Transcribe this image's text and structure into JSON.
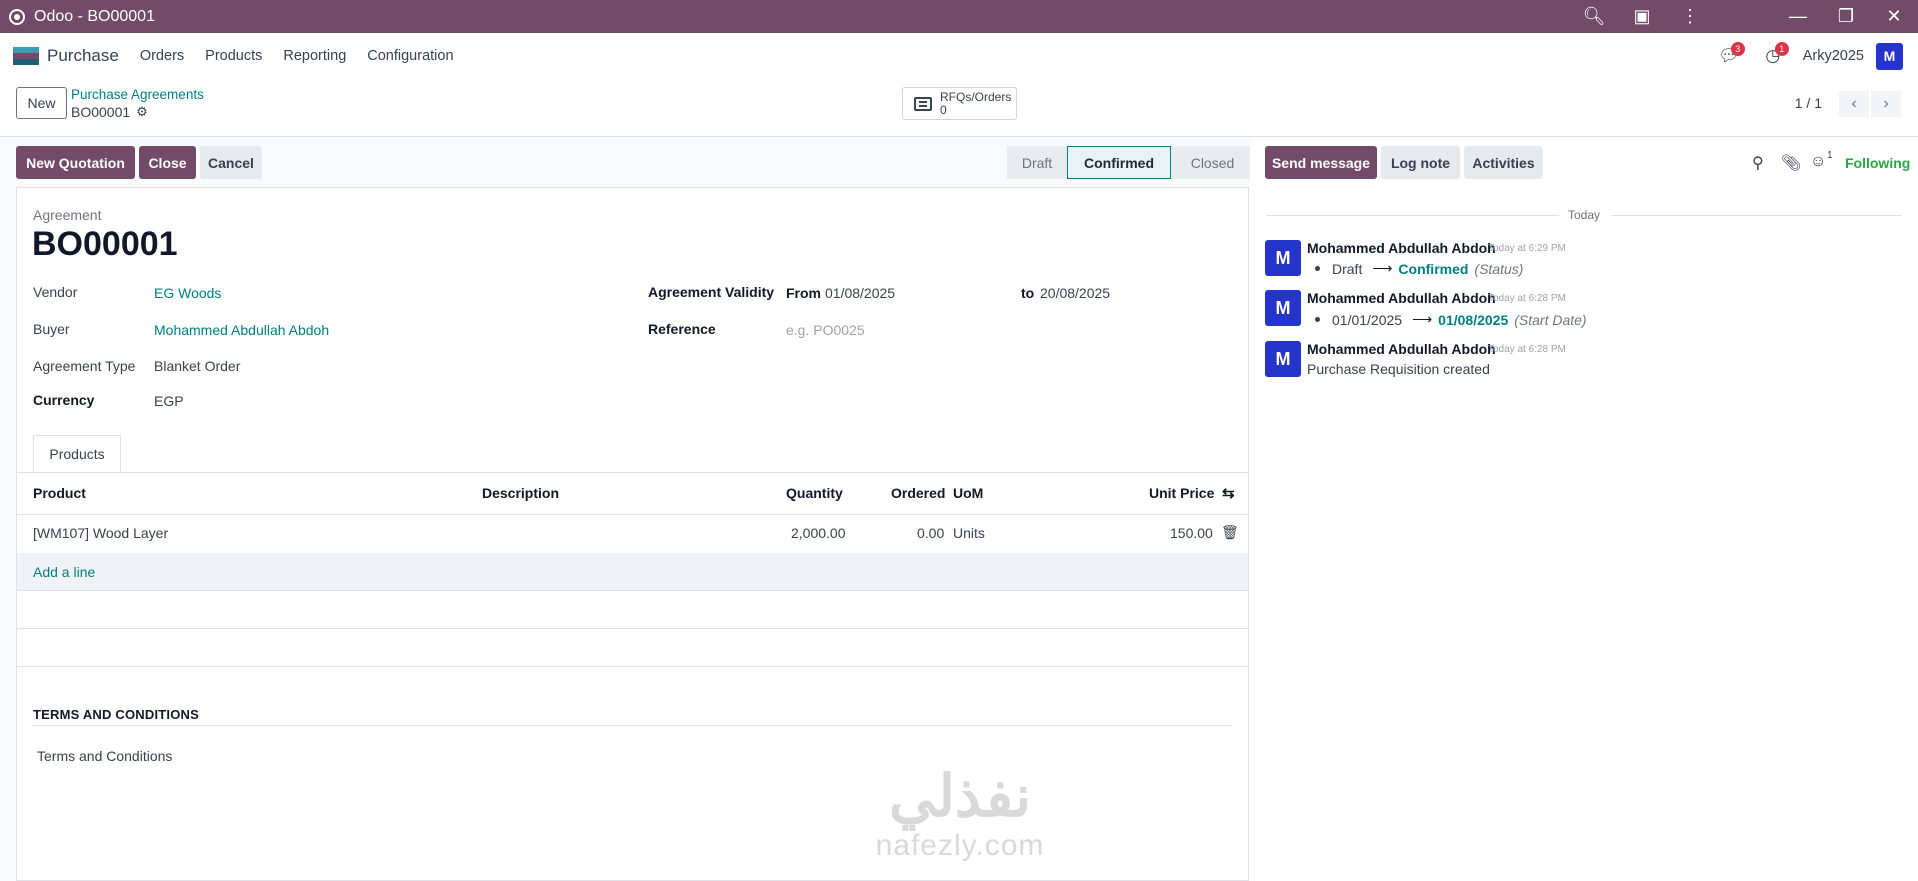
{
  "window": {
    "title": "Odoo - BO00001"
  },
  "navbar": {
    "app_name": "Purchase",
    "menu": [
      "Orders",
      "Products",
      "Reporting",
      "Configuration"
    ],
    "messages_badge": "3",
    "activities_badge": "1",
    "user_name": "Arky2025",
    "user_initial": "M"
  },
  "control_panel": {
    "new_button": "New",
    "breadcrumb_parent": "Purchase Agreements",
    "breadcrumb_current": "BO00001",
    "smart_button_label": "RFQs/Orders",
    "smart_button_count": "0",
    "pager": "1 / 1"
  },
  "actions": {
    "new_quotation": "New Quotation",
    "close": "Close",
    "cancel": "Cancel"
  },
  "status_bar": {
    "stages": [
      "Draft",
      "Confirmed",
      "Closed"
    ],
    "active": "Confirmed"
  },
  "form": {
    "agreement_label": "Agreement",
    "name": "BO00001",
    "vendor_label": "Vendor",
    "vendor": "EG Woods",
    "buyer_label": "Buyer",
    "buyer": "Mohammed Abdullah Abdoh",
    "type_label": "Agreement Type",
    "type": "Blanket Order",
    "currency_label": "Currency",
    "currency": "EGP",
    "validity_label": "Agreement Validity",
    "from_label": "From",
    "from_date": "01/08/2025",
    "to_label": "to",
    "to_date": "20/08/2025",
    "reference_label": "Reference",
    "reference_placeholder": "e.g. PO0025"
  },
  "products_tab": {
    "tab_label": "Products",
    "columns": [
      "Product",
      "Description",
      "Quantity",
      "Ordered",
      "UoM",
      "Unit Price"
    ],
    "rows": [
      {
        "product": "[WM107] Wood Layer",
        "description": "",
        "quantity": "2,000.00",
        "ordered": "0.00",
        "uom": "Units",
        "unit_price": "150.00"
      }
    ],
    "add_line": "Add a line"
  },
  "terms": {
    "heading": "TERMS AND CONDITIONS",
    "text": "Terms and Conditions"
  },
  "watermark": {
    "arabic": "نفذلي",
    "latin": "nafezly.com"
  },
  "chatter": {
    "send_message": "Send message",
    "log_note": "Log note",
    "activities": "Activities",
    "followers_count": "1",
    "following": "Following",
    "date_separator": "Today",
    "messages": [
      {
        "author": "Mohammed Abdullah Abdoh",
        "time": "Today at 6:29 PM",
        "old": "Draft",
        "new": "Confirmed",
        "field": "(Status)"
      },
      {
        "author": "Mohammed Abdullah Abdoh",
        "time": "Today at 6:28 PM",
        "old": "01/01/2025",
        "new": "01/08/2025",
        "field": "(Start Date)"
      },
      {
        "author": "Mohammed Abdullah Abdoh",
        "time": "Today at 6:28 PM",
        "body": "Purchase Requisition created"
      }
    ],
    "avatar_initial": "M"
  },
  "colors": {
    "brand": "#714b67",
    "link": "#017e84",
    "avatar": "#2534c9",
    "following": "#28a745",
    "badge": "#dc3545"
  }
}
